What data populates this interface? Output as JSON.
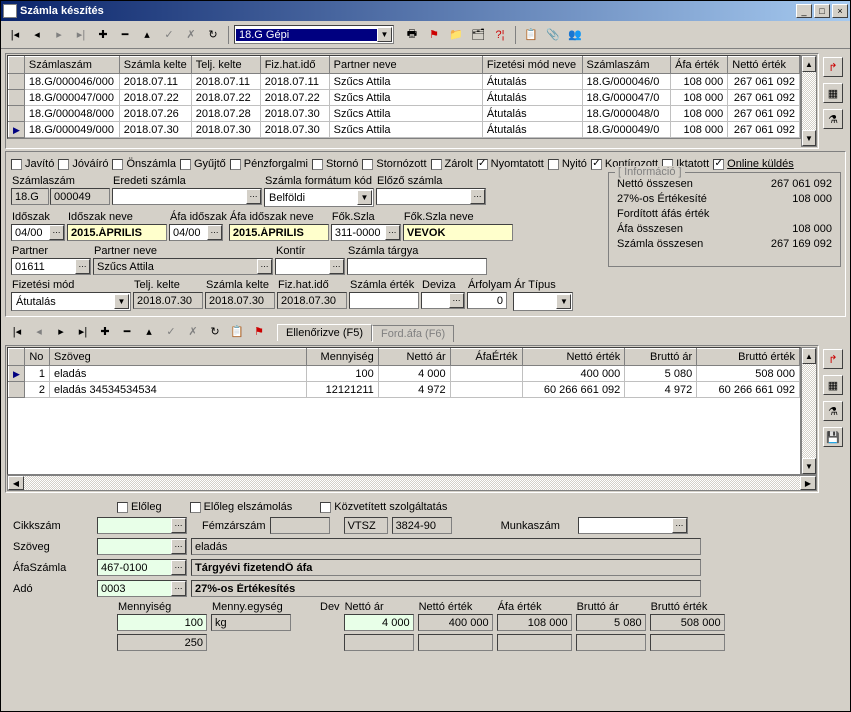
{
  "title": "Számla készítés",
  "topCombo": "18.G Gépi",
  "grid1": {
    "headers": [
      "Számlaszám",
      "Számla kelte",
      "Telj. kelte",
      "Fiz.hat.idő",
      "Partner neve",
      "Fizetési mód neve",
      "Számlaszám",
      "Áfa érték",
      "Nettó érték"
    ],
    "rows": [
      [
        "18.G/000046/000",
        "2018.07.11",
        "2018.07.11",
        "2018.07.11",
        "Szűcs Attila",
        "Átutalás",
        "18.G/000046/0",
        "108 000",
        "267 061 092"
      ],
      [
        "18.G/000047/000",
        "2018.07.22",
        "2018.07.22",
        "2018.07.22",
        "Szűcs Attila",
        "Átutalás",
        "18.G/000047/0",
        "108 000",
        "267 061 092"
      ],
      [
        "18.G/000048/000",
        "2018.07.26",
        "2018.07.28",
        "2018.07.30",
        "Szűcs Attila",
        "Átutalás",
        "18.G/000048/0",
        "108 000",
        "267 061 092"
      ],
      [
        "18.G/000049/000",
        "2018.07.30",
        "2018.07.30",
        "2018.07.30",
        "Szűcs Attila",
        "Átutalás",
        "18.G/000049/0",
        "108 000",
        "267 061 092"
      ]
    ]
  },
  "checks": [
    {
      "label": "Javító",
      "on": false
    },
    {
      "label": "Jóváíró",
      "on": false
    },
    {
      "label": "Önszámla",
      "on": false
    },
    {
      "label": "Gyűjtő",
      "on": false
    },
    {
      "label": "Pénzforgalmi",
      "on": false
    },
    {
      "label": "Stornó",
      "on": false
    },
    {
      "label": "Stornózott",
      "on": false
    },
    {
      "label": "Zárolt",
      "on": false
    },
    {
      "label": "Nyomtatott",
      "on": true
    },
    {
      "label": "Nyitó",
      "on": false
    },
    {
      "label": "Kontírozott",
      "on": true
    },
    {
      "label": "Iktatott",
      "on": false
    },
    {
      "label": "Online küldés",
      "on": true,
      "ul": true
    }
  ],
  "fields": {
    "szamlaszam_l": "Számlaszám",
    "szamlaszam_v1": "18.G",
    "szamlaszam_v2": "000049",
    "eredeti_l": "Eredeti számla",
    "eredeti_v": "",
    "format_l": "Számla formátum kód",
    "format_v": "Belföldi",
    "elozo_l": "Előző számla",
    "elozo_v": "",
    "idoszak_l": "Időszak",
    "idoszak_v": "04/00",
    "idoszakn_l": "Időszak neve",
    "idoszakn_v": "2015.ÁPRILIS",
    "afaido_l": "Áfa időszak",
    "afaido_v": "04/00",
    "afaidon_l": "Áfa időszak neve",
    "afaidon_v": "2015.ÁPRILIS",
    "fok_l": "Fők.Szla",
    "fok_v": "311-0000",
    "fokn_l": "Fők.Szla neve",
    "fokn_v": "VEVOK",
    "partner_l": "Partner",
    "partner_v": "01611",
    "partnern_l": "Partner neve",
    "partnern_v": "Szűcs Attila",
    "kontir_l": "Kontír",
    "kontir_v": "",
    "targy_l": "Számla tárgya",
    "targy_v": "",
    "fizmod_l": "Fizetési mód",
    "fizmod_v": "Átutalás",
    "telj_l": "Telj. kelte",
    "telj_v": "2018.07.30",
    "kelte_l": "Számla kelte",
    "kelte_v": "2018.07.30",
    "fizhat_l": "Fiz.hat.idő",
    "fizhat_v": "2018.07.30",
    "szertek_l": "Számla érték",
    "szertek_v": "",
    "deviza_l": "Deviza",
    "deviza_v": "",
    "arfolyam_l": "Árfolyam",
    "arfolyam_v": "0",
    "artipus_l": "Ár Típus",
    "artipus_v": ""
  },
  "info": {
    "legend": "[ Információ ]",
    "rows": [
      [
        "Nettó összesen",
        "267 061 092"
      ],
      [
        "27%-os Értékesíté",
        "108 000"
      ],
      [
        "Fordított áfás érték",
        ""
      ],
      [
        "Áfa összesen",
        "108 000"
      ],
      [
        "Számla összesen",
        "267 169 092"
      ]
    ]
  },
  "tabs": {
    "t1": "Ellenőrizve (F5)",
    "t2": "Ford.áfa (F6)"
  },
  "grid2": {
    "headers": [
      "No",
      "Szöveg",
      "Mennyiség",
      "Nettó ár",
      "ÁfaÉrték",
      "Nettó érték",
      "Bruttó ár",
      "Bruttó érték"
    ],
    "rows": [
      [
        "1",
        "eladás",
        "100",
        "4 000",
        "",
        "400 000",
        "5 080",
        "508 000"
      ],
      [
        "2",
        "eladás 34534534534",
        "12121211",
        "4 972",
        "",
        "60 266 661 092",
        "4 972",
        "60 266 661 092"
      ]
    ]
  },
  "bottomChecks": [
    {
      "label": "Előleg",
      "on": false
    },
    {
      "label": "Előleg elszámolás",
      "on": false
    },
    {
      "label": "Közvetített szolgáltatás",
      "on": false
    }
  ],
  "bottom": {
    "cikk_l": "Cikkszám",
    "cikk_v": "",
    "munka_l": "Munkaszám",
    "munka_v": "",
    "femz_l": "Fémzárszám",
    "femz_v": "",
    "vtsz_l": "VTSZ",
    "vtsz_v": "3824-90",
    "szoveg_l": "Szöveg",
    "szoveg_v": "eladás",
    "afaszamla_l": "ÁfaSzámla",
    "afaszamla_v": "467-0100",
    "afaszamla_d": "Tárgyévi fizetendŐ áfa",
    "ado_l": "Adó",
    "ado_v": "0003",
    "ado_d": "27%-os Értékesítés",
    "menny_l": "Mennyiség",
    "menny_v": "100",
    "menny_v2": "250",
    "me_l": "Menny.egység",
    "me_v": "kg",
    "dev_l": "Dev",
    "netar_l": "Nettó ár",
    "netar_v": "4 000",
    "nete_l": "Nettó érték",
    "nete_v": "400 000",
    "afae_l": "Áfa érték",
    "afae_v": "108 000",
    "brar_l": "Bruttó ár",
    "brar_v": "5 080",
    "brer_l": "Bruttó érték",
    "brer_v": "508 000"
  }
}
